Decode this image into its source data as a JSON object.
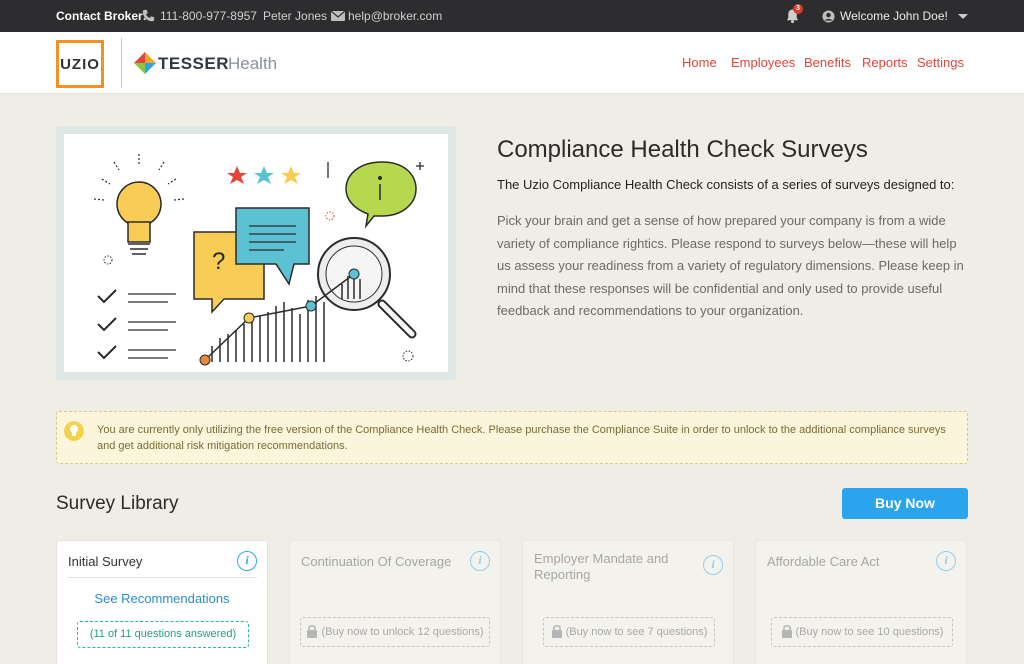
{
  "topbar": {
    "contact_label": "Contact Broker:",
    "phone": "111-800-977-8957",
    "broker_name": "Peter Jones",
    "email": "help@broker.com",
    "notification_count": "3",
    "welcome": "Welcome John Doe!"
  },
  "header": {
    "uzio_logo_text": "UZIO",
    "tesser_word": "TESSER",
    "tesser_health": "Health",
    "nav": [
      "Home",
      "Employees",
      "Benefits",
      "Reports",
      "Settings"
    ]
  },
  "hero": {
    "title": "Compliance Health Check Surveys",
    "lead": "The Uzio Compliance Health Check consists of a series of surveys designed to:",
    "body": "Pick your brain and get a sense of how prepared your company is from a wide variety of compliance rightics. Please respond to surveys below—these will help us assess your readiness from a variety of regulatory dimensions. Please keep in mind that these responses will be confidential and only used to provide useful feedback and recommendations to your organization."
  },
  "notice": {
    "text": "You are currently only utilizing the free version of the Compliance Health Check. Please purchase the Compliance Suite in order to unlock to the additional compliance surveys and get additional risk mitigation recommendations."
  },
  "library": {
    "title": "Survey Library",
    "buy_label": "Buy Now",
    "cards": [
      {
        "title": "Initial Survey",
        "link": "See Recommendations",
        "status": "(11 of 11 questions answered)"
      },
      {
        "title": "Continuation Of Coverage",
        "status": "(Buy now to unlock 12 questions)"
      },
      {
        "title": "Employer Mandate and Reporting",
        "status": "(Buy now to see 7 questions)"
      },
      {
        "title": "Affordable Care Act",
        "status": "(Buy now to see 10 questions)"
      }
    ]
  },
  "colors": {
    "accent": "#e2453a",
    "primary_button": "#2aa4ec",
    "uzio_orange": "#f29220",
    "topbar": "#2d2d2f"
  }
}
